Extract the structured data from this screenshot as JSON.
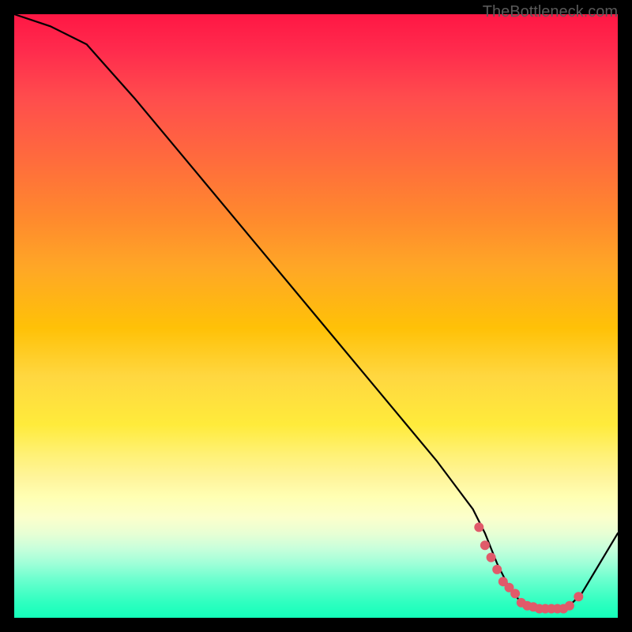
{
  "watermark": "TheBottleneck.com",
  "chart_data": {
    "type": "line",
    "title": "",
    "xlabel": "",
    "ylabel": "",
    "xlim": [
      0,
      100
    ],
    "ylim": [
      0,
      100
    ],
    "series": [
      {
        "name": "curve",
        "x": [
          0,
          6,
          12,
          20,
          30,
          40,
          50,
          60,
          70,
          76,
          78,
          80,
          82,
          84,
          86,
          88,
          90,
          92,
          94,
          100
        ],
        "values": [
          100,
          98,
          95,
          86,
          74,
          62,
          50,
          38,
          26,
          18,
          14,
          9,
          5,
          2.5,
          1.8,
          1.5,
          1.5,
          2,
          4,
          14
        ]
      }
    ],
    "markers": {
      "name": "highlight-dots",
      "color": "#e05a6a",
      "x": [
        77,
        78,
        79,
        80,
        81,
        82,
        83,
        84,
        85,
        86,
        87,
        88,
        89,
        90,
        91,
        92,
        93.5
      ],
      "values": [
        15,
        12,
        10,
        8,
        6,
        5,
        4,
        2.5,
        2,
        1.8,
        1.5,
        1.5,
        1.5,
        1.5,
        1.5,
        2,
        3.5
      ]
    },
    "gradient_stops": [
      {
        "pos": 0,
        "color": "#ff1744"
      },
      {
        "pos": 50,
        "color": "#ffc107"
      },
      {
        "pos": 75,
        "color": "#ffeb3b"
      },
      {
        "pos": 100,
        "color": "#14ffba"
      }
    ]
  }
}
